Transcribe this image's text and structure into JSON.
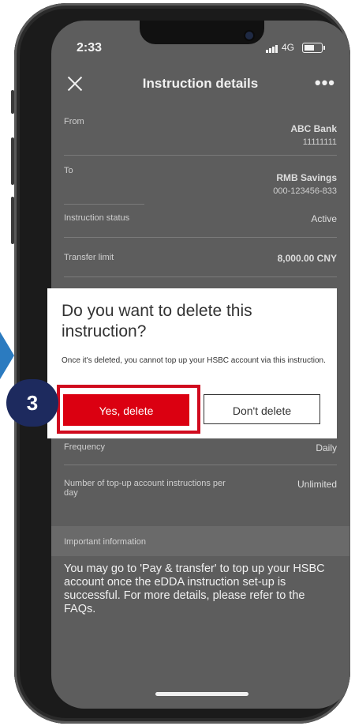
{
  "status_bar": {
    "time": "2:33",
    "network": "4G"
  },
  "header": {
    "title": "Instruction details",
    "more": "•••"
  },
  "details": {
    "from_label": "From",
    "from_bank": "ABC Bank",
    "from_account": "11111111",
    "to_label": "To",
    "to_name": "RMB Savings",
    "to_account": "000-123456-833",
    "status_label": "Instruction status",
    "status_value": "Active",
    "limit_label": "Transfer limit",
    "limit_value": "8,000.00 CNY",
    "frequency_label": "Frequency",
    "frequency_value": "Daily",
    "topup_label": "Number of top-up account instructions per day",
    "topup_value": "Unlimited"
  },
  "important": {
    "heading": "Important information",
    "text": "You may go to 'Pay & transfer' to top up your HSBC account once the eDDA instruction set-up is successful. For more details, please refer to the FAQs."
  },
  "dialog": {
    "title": "Do you want to delete this instruction?",
    "message": "Once it's deleted, you cannot top up your HSBC account via this instruction.",
    "confirm_label": "Yes, delete",
    "cancel_label": "Don't delete"
  },
  "annotation": {
    "step": "3"
  },
  "colors": {
    "brand_red": "#db0011",
    "step_badge": "#1d2a5e",
    "arrow": "#2b7bc0"
  }
}
